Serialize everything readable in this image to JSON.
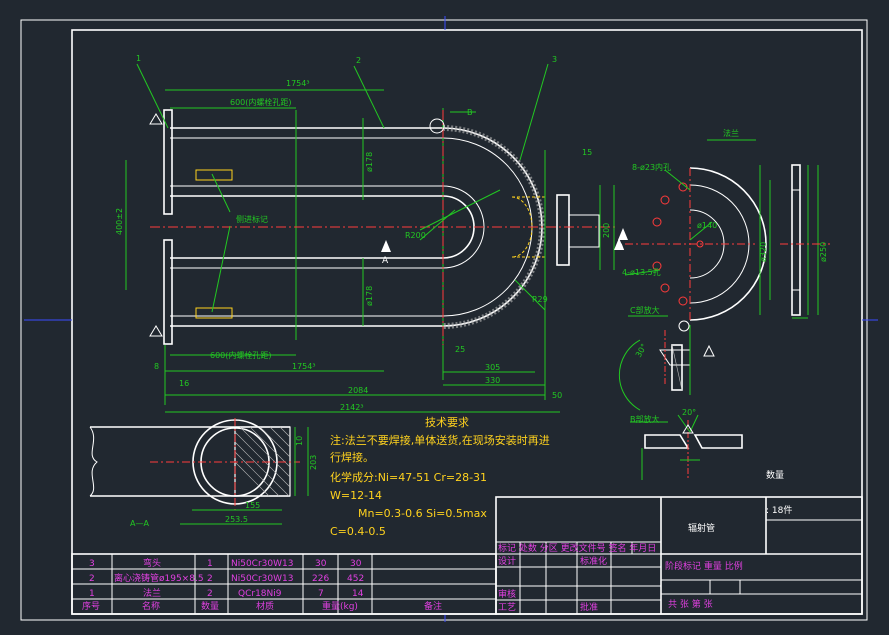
{
  "labels": {
    "dim_175_top": "1754³",
    "dim_600_top": "600(内螺栓孔距)",
    "dim_175_bot": "1754³",
    "dim_600_bot": "600(内螺栓孔距)",
    "dim_400": "400±2",
    "dim_2084": "2084",
    "dim_2142": "2142³",
    "dim_305": "305",
    "dim_330": "330",
    "dim_50": "50",
    "dim_25": "25",
    "dim_16": "16",
    "dim_8": "8",
    "dim_200": "200",
    "dim_R200": "R200",
    "dim_R29": "R29",
    "phi178_a": "ø178",
    "phi178_b": "ø178",
    "side_mark": "侧进标记",
    "flange_title": "法兰",
    "holes_8": "8-ø23内孔",
    "holes_4": "4-ø13.5孔",
    "phi140": "ø140",
    "phi320": "ø320",
    "phi250": "ø250",
    "detail_c": "C部放大",
    "detail_b": "B部放大",
    "ang_20": "20°",
    "ang_30": "30°",
    "dim_203": "203",
    "dim_10": "10",
    "dim_155": "155",
    "dim_2535": "253.5",
    "section_aa": "A—A",
    "letter_a1": "A",
    "letter_a2": "A",
    "callout_1": "1",
    "callout_2": "2",
    "callout_3": "3",
    "callout_b": "B",
    "dim_15": "15"
  },
  "tech": {
    "title": "技术要求",
    "line1": "注:法兰不要焊接,单体送货,在现场安装时再进",
    "line2": "行焊接。",
    "line3": "化学成分:Ni=47-51    Cr=28-31",
    "line4": "W=12-14",
    "line5": "Mn=0.3-0.6  Si=0.5max",
    "line6": "C=0.4-0.5"
  },
  "quantity": {
    "label": "数量",
    "value": ": 18件"
  },
  "title_block": {
    "part_name": "辐射管",
    "rev_header": "标记 处数 分区 更改文件号 签名 年月日",
    "design": "设计",
    "standard": "标准化",
    "review": "审核",
    "process": "工艺",
    "approve": "批准",
    "stage": "阶段标记  重量  比例",
    "sheets": "共   张  第   张"
  },
  "bom": {
    "rows": [
      {
        "no": "3",
        "name": "弯头",
        "qty": "1",
        "material": "Ni50Cr30W13",
        "w1": "30",
        "w2": "30"
      },
      {
        "no": "2",
        "name": "离心浇铸管ø195×8.5",
        "qty": "2",
        "material": "Ni50Cr30W13",
        "w1": "226",
        "w2": "452"
      },
      {
        "no": "1",
        "name": "法兰",
        "qty": "2",
        "material": "QCr18Ni9",
        "w1": "7",
        "w2": "14"
      }
    ],
    "header": {
      "no": "序号",
      "name": "名称",
      "qty": "数量",
      "material": "材质",
      "weight": "重量(kg)",
      "note": "备注"
    }
  }
}
